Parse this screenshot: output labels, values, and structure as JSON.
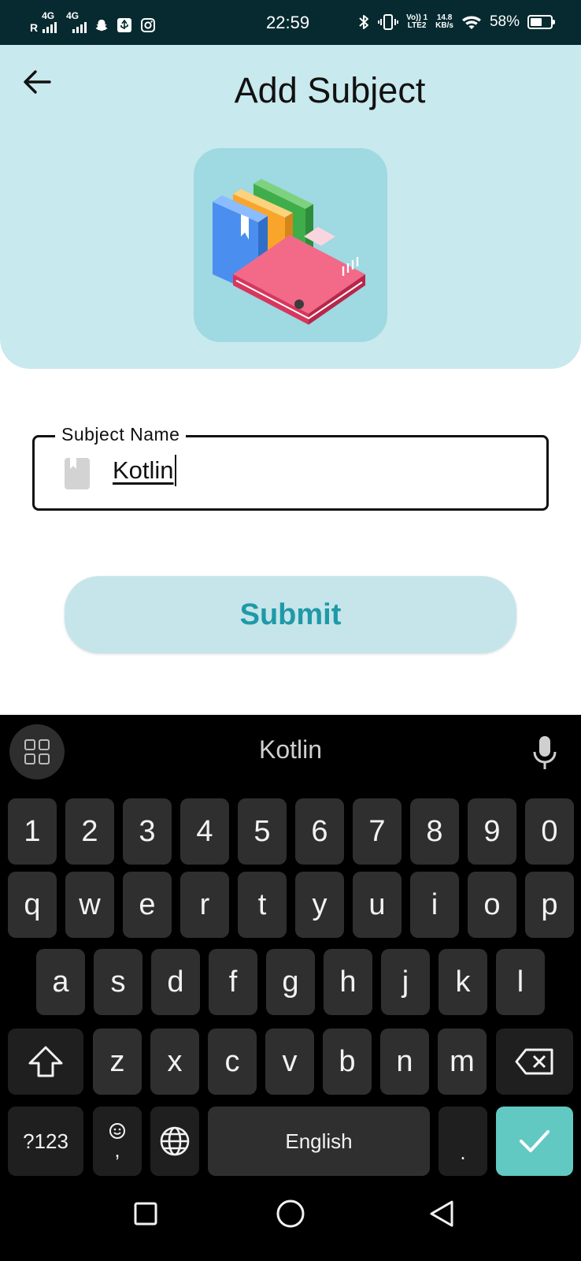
{
  "status_bar": {
    "roaming": "R",
    "net1": "4G",
    "net2": "4G",
    "time": "22:59",
    "volte_top": "Vo)) 1",
    "volte_bottom": "LTE2",
    "speed_value": "14.8",
    "speed_unit": "KB/s",
    "battery_percent": "58%",
    "battery_level": 0.58
  },
  "header": {
    "title": "Add Subject",
    "background_color": "#c8e9ee",
    "logo_tile_color": "#9fd9e1"
  },
  "form": {
    "subject_label": "Subject Name",
    "subject_value": "Kotlin",
    "submit_label": "Submit",
    "submit_color": "#1f99a8"
  },
  "keyboard": {
    "suggestion": "Kotlin",
    "row_numbers": [
      "1",
      "2",
      "3",
      "4",
      "5",
      "6",
      "7",
      "8",
      "9",
      "0"
    ],
    "row_q": [
      "q",
      "w",
      "e",
      "r",
      "t",
      "y",
      "u",
      "i",
      "o",
      "p"
    ],
    "row_a": [
      "a",
      "s",
      "d",
      "f",
      "g",
      "h",
      "j",
      "k",
      "l"
    ],
    "row_z": [
      "z",
      "x",
      "c",
      "v",
      "b",
      "n",
      "m"
    ],
    "symbols_label": "?123",
    "comma_label": ",",
    "space_label": "English",
    "period_label": ".",
    "enter_color": "#62c9c2"
  },
  "icons": [
    "back-arrow-icon",
    "books-icon",
    "book-icon",
    "keyboard-tools-icon",
    "mic-icon",
    "shift-icon",
    "backspace-icon",
    "emoji-icon",
    "globe-icon",
    "check-icon",
    "nav-recents-icon",
    "nav-home-icon",
    "nav-back-icon",
    "bluetooth-icon",
    "vibrate-icon",
    "wifi-icon",
    "battery-icon",
    "snapchat-icon",
    "instagram-icon"
  ]
}
